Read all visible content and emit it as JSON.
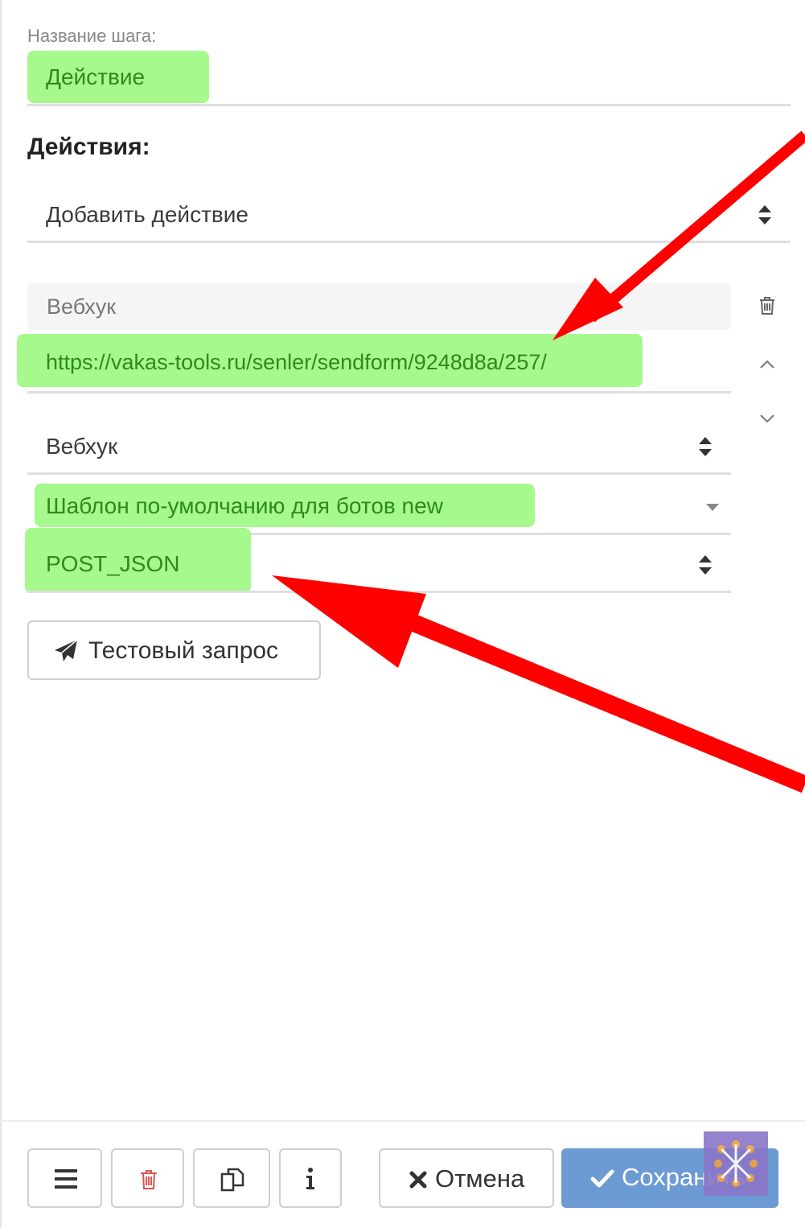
{
  "step": {
    "label": "Название шага:",
    "name_value": "Действие"
  },
  "actions": {
    "title": "Действия:",
    "add_select": "Добавить действие",
    "webhook": {
      "header": "Вебхук",
      "url": "https://vakas-tools.ru/senler/sendform/9248d8a/257/",
      "type_select": "Вебхук",
      "template_select": "Шаблон по-умолчанию для ботов new",
      "method_select": "POST_JSON"
    },
    "test_button": "Тестовый запрос"
  },
  "footer": {
    "cancel_label": "Отмена",
    "save_label": "Сохранить"
  },
  "colors": {
    "highlight": "#a6f98c",
    "arrow": "#ff0000",
    "save_button": "#6c9ad3",
    "delete_icon": "#d9534f"
  },
  "icons": [
    "trash-icon",
    "chevron-up-icon",
    "chevron-down-icon",
    "sort-icon",
    "caret-down-icon",
    "paper-plane-icon",
    "menu-icon",
    "copy-icon",
    "info-icon",
    "close-icon",
    "check-icon"
  ]
}
